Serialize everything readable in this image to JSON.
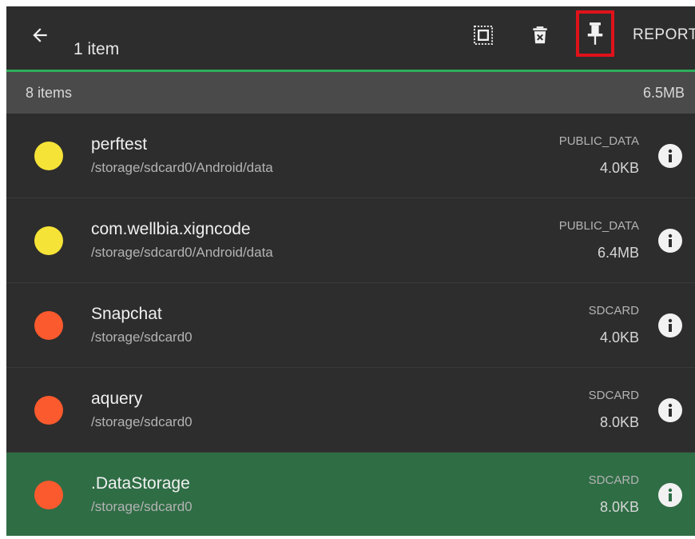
{
  "toolbar": {
    "title": "1 item",
    "report_label": "REPORT",
    "back_icon": "arrow-left-icon",
    "select_all_icon": "select-all-icon",
    "delete_icon": "delete-icon",
    "pin_icon": "pin-icon",
    "accent_color": "#2eae5a",
    "highlight_color": "#e0121a"
  },
  "summary": {
    "count": "8 items",
    "size": "6.5MB"
  },
  "items": [
    {
      "name": "perftest",
      "path": "/storage/sdcard0/Android/data",
      "type": "PUBLIC_DATA",
      "size": "4.0KB",
      "dot_color": "#f6e337",
      "selected": false
    },
    {
      "name": "com.wellbia.xigncode",
      "path": "/storage/sdcard0/Android/data",
      "type": "PUBLIC_DATA",
      "size": "6.4MB",
      "dot_color": "#f6e337",
      "selected": false
    },
    {
      "name": "Snapchat",
      "path": "/storage/sdcard0",
      "type": "SDCARD",
      "size": "4.0KB",
      "dot_color": "#fa5a2d",
      "selected": false
    },
    {
      "name": "aquery",
      "path": "/storage/sdcard0",
      "type": "SDCARD",
      "size": "8.0KB",
      "dot_color": "#fa5a2d",
      "selected": false
    },
    {
      "name": ".DataStorage",
      "path": "/storage/sdcard0",
      "type": "SDCARD",
      "size": "8.0KB",
      "dot_color": "#fa5a2d",
      "selected": true
    }
  ]
}
